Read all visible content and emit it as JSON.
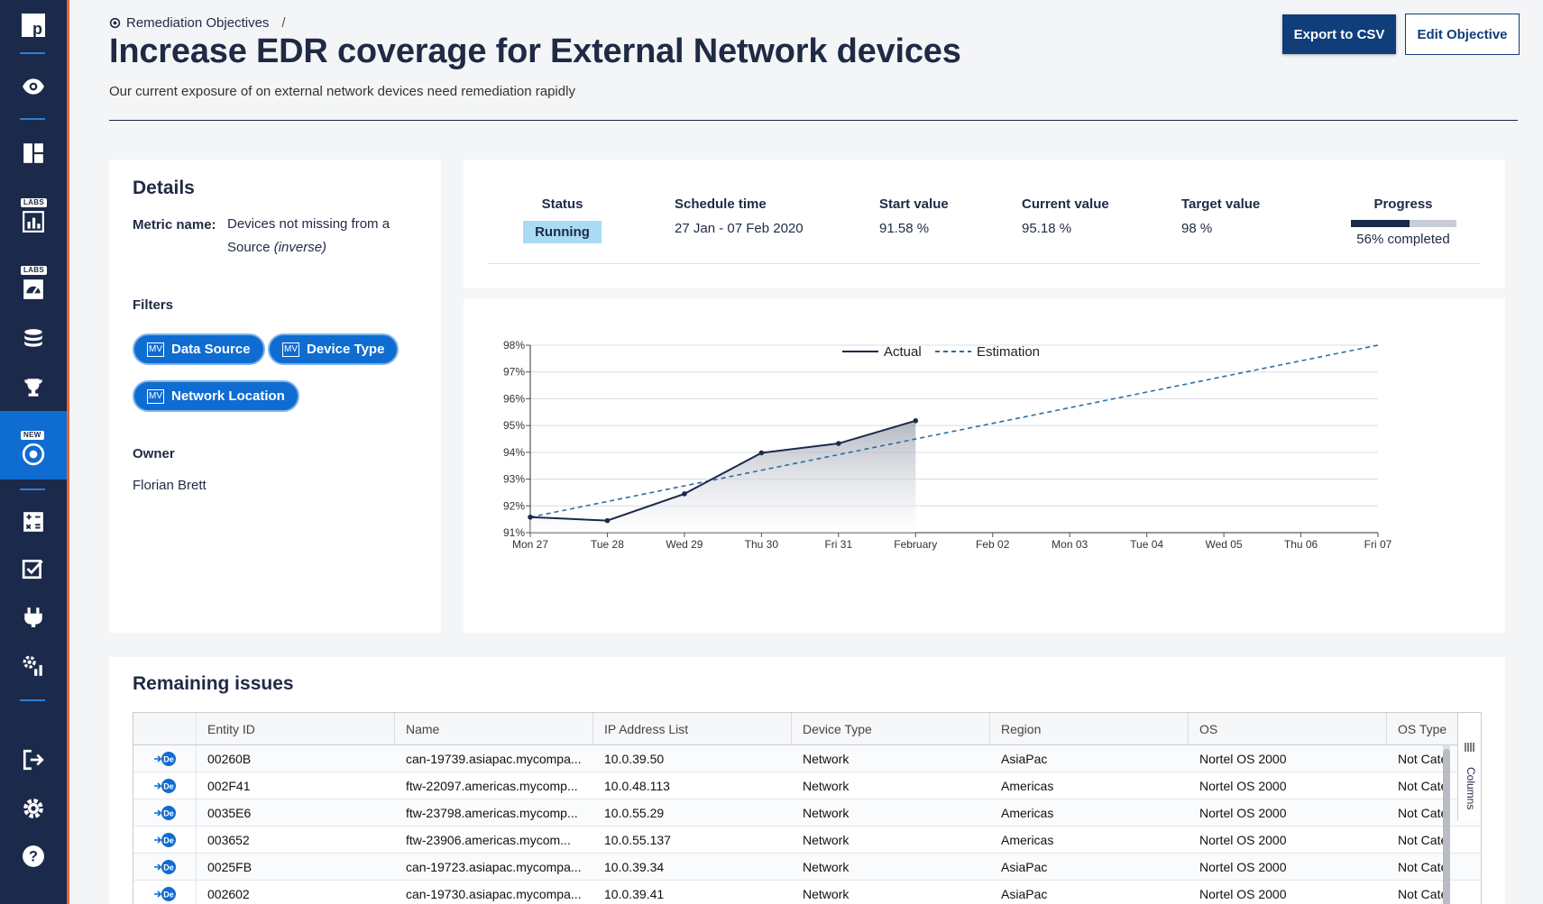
{
  "sidebar": {
    "logo": "p",
    "badges": {
      "labs1": "LABS",
      "labs2": "LABS",
      "new": "NEW"
    },
    "accent": "#0f6cd1",
    "bg": "#1b2a4a"
  },
  "breadcrumb": {
    "item": "Remediation Objectives",
    "separator": "/"
  },
  "header": {
    "title": "Increase EDR coverage for External Network devices",
    "subtitle": "Our current exposure of on external network devices need remediation rapidly",
    "export_label": "Export to CSV",
    "edit_label": "Edit Objective"
  },
  "details": {
    "heading": "Details",
    "metric_label": "Metric name:",
    "metric_value": "Devices not missing from a Source",
    "metric_suffix": "(inverse)",
    "filters_heading": "Filters",
    "filters": [
      "Data Source",
      "Device Type",
      "Network Location"
    ],
    "filter_icon_text": "MV",
    "owner_heading": "Owner",
    "owner": "Florian Brett"
  },
  "stats": {
    "status": {
      "label": "Status",
      "value": "Running"
    },
    "schedule": {
      "label": "Schedule time",
      "value": "27 Jan - 07 Feb 2020"
    },
    "start": {
      "label": "Start value",
      "value": "91.58 %"
    },
    "current": {
      "label": "Current value",
      "value": "95.18 %"
    },
    "target": {
      "label": "Target value",
      "value": "98 %"
    },
    "progress": {
      "label": "Progress",
      "value": "56% completed",
      "fraction": 0.56
    }
  },
  "chart_data": {
    "type": "line",
    "title": "",
    "xlabel": "",
    "ylabel": "",
    "categories": [
      "Mon 27",
      "Tue 28",
      "Wed 29",
      "Thu 30",
      "Fri 31",
      "February",
      "Feb 02",
      "Mon 03",
      "Tue 04",
      "Wed 05",
      "Thu 06",
      "Fri 07"
    ],
    "yticks": [
      "91%",
      "92%",
      "93%",
      "94%",
      "95%",
      "96%",
      "97%",
      "98%"
    ],
    "ylim": [
      91,
      98
    ],
    "legend_position": "top-center",
    "grid": true,
    "series": [
      {
        "name": "Actual",
        "style": "solid",
        "color": "#1b2a4a",
        "x_index": [
          0,
          1,
          2,
          3,
          4,
          5
        ],
        "values": [
          91.58,
          91.45,
          92.45,
          93.98,
          94.33,
          95.18
        ]
      },
      {
        "name": "Estimation",
        "style": "dashed",
        "color": "#2c6e9e",
        "x_index": [
          0,
          11
        ],
        "values": [
          91.58,
          98
        ]
      }
    ]
  },
  "issues": {
    "heading": "Remaining issues",
    "columns": [
      "Entity ID",
      "Name",
      "IP Address List",
      "Device Type",
      "Region",
      "OS",
      "OS Type"
    ],
    "columns_panel": "Columns",
    "row_icon_text": "De",
    "rows": [
      [
        "00260B",
        "can-19739.asiapac.mycompa...",
        "10.0.39.50",
        "Network",
        "AsiaPac",
        "Nortel OS 2000",
        "Not Cate"
      ],
      [
        "002F41",
        "ftw-22097.americas.mycomp...",
        "10.0.48.113",
        "Network",
        "Americas",
        "Nortel OS 2000",
        "Not Cate"
      ],
      [
        "0035E6",
        "ftw-23798.americas.mycomp...",
        "10.0.55.29",
        "Network",
        "Americas",
        "Nortel OS 2000",
        "Not Cate"
      ],
      [
        "003652",
        "ftw-23906.americas.mycom...",
        "10.0.55.137",
        "Network",
        "Americas",
        "Nortel OS 2000",
        "Not Cate"
      ],
      [
        "0025FB",
        "can-19723.asiapac.mycompa...",
        "10.0.39.34",
        "Network",
        "AsiaPac",
        "Nortel OS 2000",
        "Not Cate"
      ],
      [
        "002602",
        "can-19730.asiapac.mycompa...",
        "10.0.39.41",
        "Network",
        "AsiaPac",
        "Nortel OS 2000",
        "Not Cate"
      ]
    ]
  }
}
